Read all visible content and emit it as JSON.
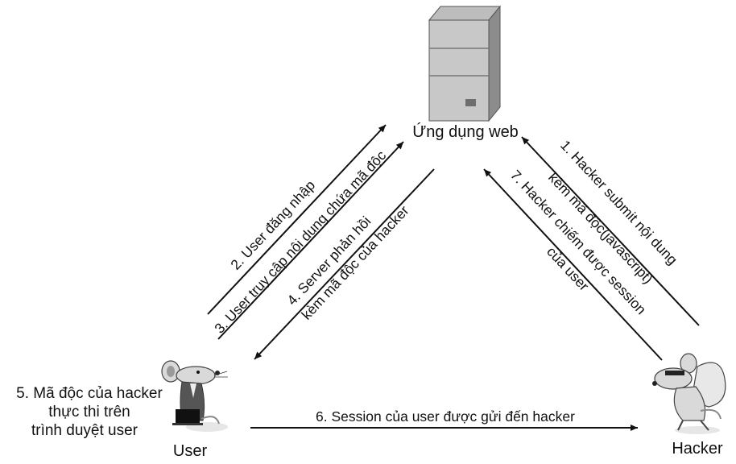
{
  "nodes": {
    "server": {
      "label": "Ứng dụng web",
      "icon": "server-tower-icon"
    },
    "user": {
      "label": "User",
      "icon": "rat-user-at-laptop-icon"
    },
    "hacker": {
      "label": "Hacker",
      "icon": "masked-rat-burglar-icon"
    }
  },
  "side_note": {
    "lines": [
      "5. Mã độc của hacker",
      "thực thi trên",
      "trình duyệt user"
    ]
  },
  "edges": {
    "step1": {
      "lines": [
        "1. Hacker submit nội dung",
        "kèm mã độc(javascript)"
      ]
    },
    "step2": {
      "lines": [
        "2. User đăng nhập"
      ]
    },
    "step3": {
      "lines": [
        "3. User truy cập nội dung chứa mã độc"
      ]
    },
    "step4": {
      "lines": [
        "4. Server phản hồi",
        "kèm mã độc của hacker"
      ]
    },
    "step6": {
      "lines": [
        "6. Session của user được gửi đến hacker"
      ]
    },
    "step7": {
      "lines": [
        "7. Hacker chiếm được session",
        "của user"
      ]
    }
  },
  "colors": {
    "line": "#111111",
    "server_light": "#c8c8c8",
    "server_mid": "#a9a9a9",
    "server_dark": "#6e6e6e",
    "rat_fill": "#d9d9d9",
    "rat_shade": "#9a9a9a",
    "suit": "#555555"
  }
}
